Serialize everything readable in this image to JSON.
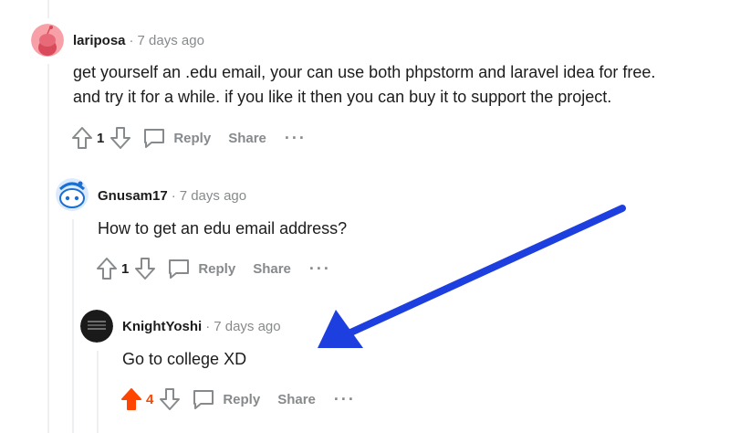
{
  "comments": [
    {
      "author": "lariposa",
      "separator": "·",
      "time": "7 days ago",
      "lines": [
        "get yourself an .edu email, your can use both phpstorm and laravel idea for free.",
        "and try it for a while. if you like it then you can buy it to support the project."
      ],
      "score": "1",
      "reply_label": "Reply",
      "share_label": "Share",
      "more_label": "···"
    },
    {
      "author": "Gnusam17",
      "separator": "·",
      "time": "7 days ago",
      "lines": [
        "How to get an edu email address?"
      ],
      "score": "1",
      "reply_label": "Reply",
      "share_label": "Share",
      "more_label": "···"
    },
    {
      "author": "KnightYoshi",
      "separator": "·",
      "time": "7 days ago",
      "lines": [
        "Go to college XD"
      ],
      "score": "4",
      "reply_label": "Reply",
      "share_label": "Share",
      "more_label": "···"
    }
  ],
  "colors": {
    "upvoted": "#ff4500",
    "muted": "#878a8c",
    "annotation_arrow": "#1e3fe0"
  }
}
